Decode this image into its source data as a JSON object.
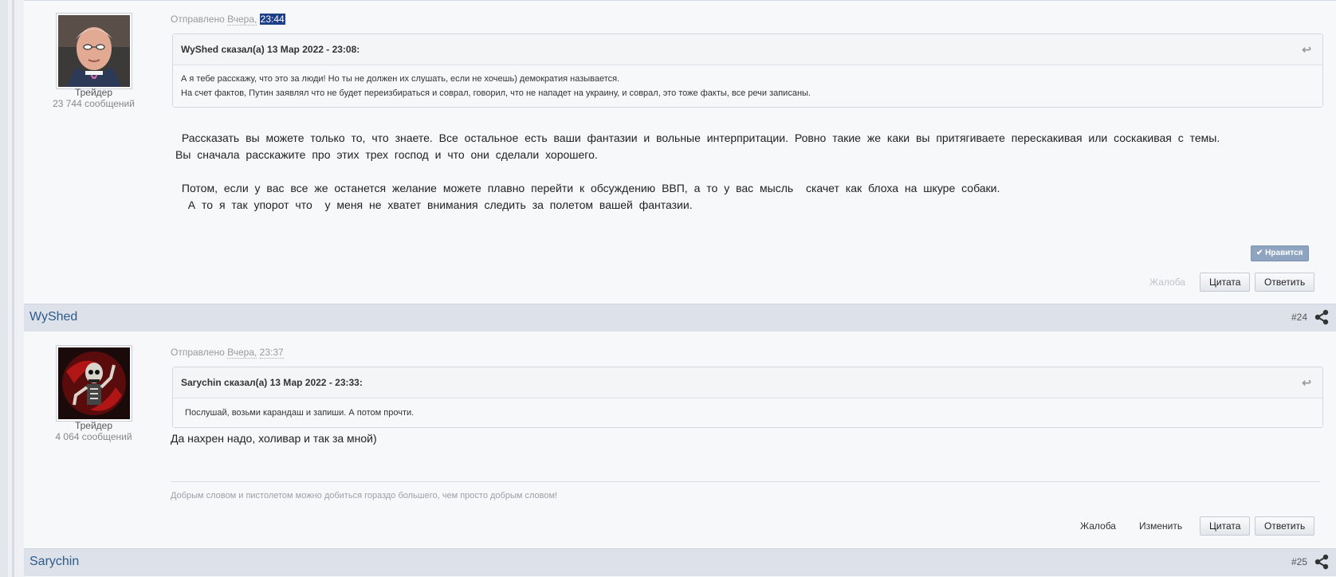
{
  "post1": {
    "rank": "Трейдер",
    "count": "23 744 сообщений",
    "posted_prefix": "Отправлено",
    "posted_day": "Вчера,",
    "posted_time": "23:44",
    "quote_header": "WyShed сказал(а) 13 Мар 2022 - 23:08:",
    "quote_lines": [
      "А я тебе расскажу, что это за люди! Но ты не должен их слушать, если не хочешь) демократия называется.",
      "На счет фактов, Путин заявлял что не будет переизбираться и соврал, говорил, что не нападет на украину, и соврал, это тоже факты, все речи записаны."
    ],
    "body_lines": [
      " Рассказать вы можете только то, что знаете. Все остальное есть ваши фантазии и вольные интерпритации. Ровно такие же каки вы притягиваете перескакивая или соскакивая с темы.",
      "Вы сначала расскажите про этих трех господ и что они сделали хорошего.",
      "",
      " Потом, если у вас все же останется желание можете плавно перейти к обсуждению ВВП, а то у вас мысль  скачет как блоха на шкуре собаки.",
      "  А то я так упорот что  у меня не хватет внимания следить за полетом вашей фантазии."
    ],
    "like_label": "Нравится",
    "report_label": "Жалоба",
    "quote_button": "Цитата",
    "reply_button": "Ответить"
  },
  "namebar1": {
    "username": "WyShed",
    "post_number": "#24"
  },
  "post2": {
    "rank": "Трейдер",
    "count": "4 064 сообщений",
    "posted_prefix": "Отправлено",
    "posted_day": "Вчера,",
    "posted_time": "23:37",
    "quote_header": "Sarychin сказал(а) 13 Мар 2022 - 23:33:",
    "quote_lines": [
      " Послушай, возьми карандаш и запиши. А потом прочти."
    ],
    "body_text": "Да нахрен надо, холивар и так за мной)",
    "signature": "Добрым словом и пистолетом можно добиться гораздо большего, чем просто добрым словом!",
    "report_label": "Жалоба",
    "edit_label": "Изменить",
    "quote_button": "Цитата",
    "reply_button": "Ответить"
  },
  "namebar2": {
    "username": "Sarychin",
    "post_number": "#25"
  },
  "colors": {
    "link_blue": "#2d5b8a",
    "namebar_bg": "#dde1ea",
    "like_bg": "#8ea4c0"
  }
}
